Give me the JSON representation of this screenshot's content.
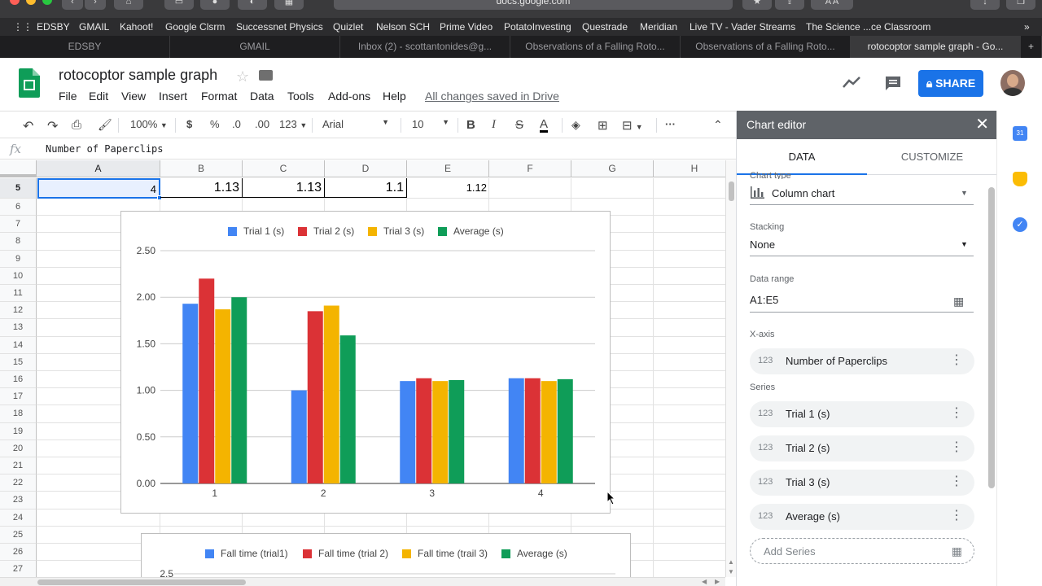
{
  "browser": {
    "url": "docs.google.com",
    "bookmarks": [
      "EDSBY",
      "GMAIL",
      "Kahoot!",
      "Google Clsrm",
      "Successnet Physics",
      "Quizlet",
      "Nelson SCH",
      "Prime Video",
      "PotatoInvesting",
      "Questrade",
      "Meridian",
      "Live TV - Vader Streams",
      "The Science ...ce Classroom"
    ],
    "tabs": [
      "EDSBY",
      "GMAIL",
      "Inbox (2) - scottantonides@g...",
      "Observations of a Falling Roto...",
      "Observations of a Falling Roto...",
      "rotocoptor sample graph - Go..."
    ]
  },
  "doc": {
    "title": "rotocoptor sample graph",
    "menus": [
      "File",
      "Edit",
      "View",
      "Insert",
      "Format",
      "Data",
      "Tools",
      "Add-ons",
      "Help"
    ],
    "saved_status": "All changes saved in Drive",
    "share_label": "SHARE"
  },
  "toolbar": {
    "zoom": "100%",
    "currency": "$",
    "percent": "%",
    "dec_less": ".0",
    "dec_more": ".00",
    "format": "123",
    "font": "Arial",
    "font_size": "10",
    "bold": "B",
    "italic": "I",
    "strike": "S",
    "text_color": "A",
    "more": "···"
  },
  "formula_bar": {
    "fx": "fx",
    "content": "Number of Paperclips"
  },
  "grid": {
    "columns": [
      "A",
      "B",
      "C",
      "D",
      "E",
      "F",
      "G",
      "H"
    ],
    "rows": [
      "5",
      "6",
      "7",
      "8",
      "9",
      "10",
      "11",
      "12",
      "13",
      "14",
      "15",
      "16",
      "17",
      "18",
      "19",
      "20",
      "21",
      "22",
      "23",
      "24",
      "25",
      "26",
      "27"
    ],
    "row5": [
      "4",
      "1.13",
      "1.13",
      "1.1",
      "1.12"
    ]
  },
  "chart_data": [
    {
      "type": "bar",
      "categories": [
        "1",
        "2",
        "3",
        "4"
      ],
      "series": [
        {
          "name": "Trial 1 (s)",
          "color": "#4285f4",
          "values": [
            1.93,
            1.0,
            1.1,
            1.13
          ]
        },
        {
          "name": "Trial 2 (s)",
          "color": "#db3236",
          "values": [
            2.2,
            1.85,
            1.13,
            1.13
          ]
        },
        {
          "name": "Trial 3 (s)",
          "color": "#f4b400",
          "values": [
            1.87,
            1.91,
            1.1,
            1.1
          ]
        },
        {
          "name": "Average (s)",
          "color": "#0f9d58",
          "values": [
            2.0,
            1.59,
            1.11,
            1.12
          ]
        }
      ],
      "yticks": [
        "0.00",
        "0.50",
        "1.00",
        "1.50",
        "2.00",
        "2.50"
      ],
      "ylim": [
        0,
        2.5
      ],
      "legend": "top",
      "grid": true
    },
    {
      "type": "bar",
      "series": [
        {
          "name": "Fall time (trial1)",
          "color": "#4285f4"
        },
        {
          "name": "Fall time (trial 2)",
          "color": "#db3236"
        },
        {
          "name": "Fall time (trail 3)",
          "color": "#f4b400"
        },
        {
          "name": "Average (s)",
          "color": "#0f9d58"
        }
      ],
      "yticks": [
        "2.5"
      ],
      "legend": "top"
    }
  ],
  "editor": {
    "title": "Chart editor",
    "tabs": [
      "DATA",
      "CUSTOMIZE"
    ],
    "chart_type_label": "Chart type",
    "chart_type": "Column chart",
    "stacking_label": "Stacking",
    "stacking": "None",
    "range_label": "Data range",
    "range": "A1:E5",
    "xaxis_label": "X-axis",
    "xaxis": "Number of Paperclips",
    "series_label": "Series",
    "series": [
      "Trial 1 (s)",
      "Trial 2 (s)",
      "Trial 3 (s)",
      "Average (s)"
    ],
    "num_tag": "123",
    "add_series": "Add Series"
  }
}
